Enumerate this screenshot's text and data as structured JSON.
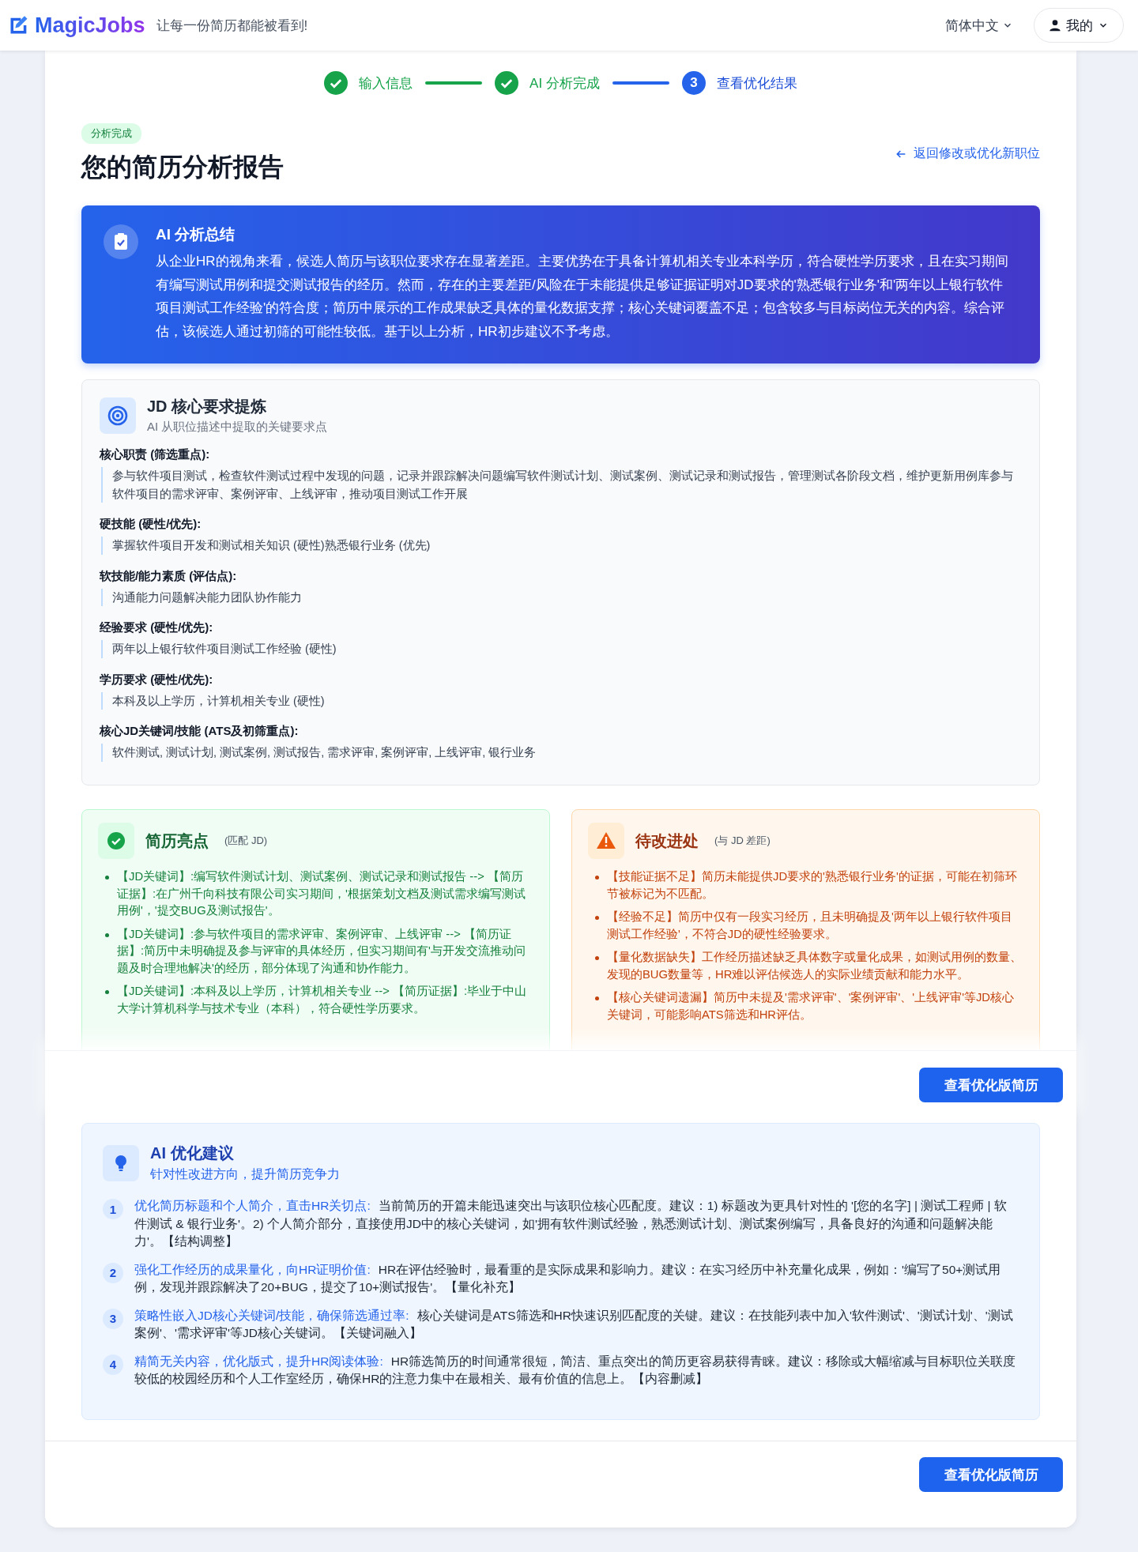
{
  "header": {
    "logo": "MagicJobs",
    "tagline": "让每一份简历都能被看到!",
    "language": "简体中文",
    "user_menu": "我的"
  },
  "steps": [
    {
      "label": "输入信息",
      "completed": true
    },
    {
      "label": "AI 分析完成",
      "completed": true
    },
    {
      "label": "查看优化结果",
      "completed": false,
      "number": "3"
    }
  ],
  "report": {
    "badge": "分析完成",
    "title": "您的简历分析报告",
    "back_link": "返回修改或优化新职位"
  },
  "summary": {
    "title": "AI 分析总结",
    "text": "从企业HR的视角来看，候选人简历与该职位要求存在显著差距。主要优势在于具备计算机相关专业本科学历，符合硬性学历要求，且在实习期间有编写测试用例和提交测试报告的经历。然而，存在的主要差距/风险在于未能提供足够证据证明对JD要求的'熟悉银行业务'和'两年以上银行软件项目测试工作经验'的符合度；简历中展示的工作成果缺乏具体的量化数据支撑；核心关键词覆盖不足；包含较多与目标岗位无关的内容。综合评估，该候选人通过初筛的可能性较低。基于以上分析，HR初步建议不予考虑。"
  },
  "jd": {
    "title": "JD 核心要求提炼",
    "subtitle": "AI 从职位描述中提取的关键要求点",
    "sections": [
      {
        "heading": "核心职责 (筛选重点):",
        "text": "参与软件项目测试，检查软件测试过程中发现的问题，记录并跟踪解决问题编写软件测试计划、测试案例、测试记录和测试报告，管理测试各阶段文档，维护更新用例库参与软件项目的需求评审、案例评审、上线评审，推动项目测试工作开展"
      },
      {
        "heading": "硬技能 (硬性/优先):",
        "text": "掌握软件项目开发和测试相关知识 (硬性)熟悉银行业务 (优先)"
      },
      {
        "heading": "软技能/能力素质 (评估点):",
        "text": "沟通能力问题解决能力团队协作能力"
      },
      {
        "heading": "经验要求 (硬性/优先):",
        "text": "两年以上银行软件项目测试工作经验 (硬性)"
      },
      {
        "heading": "学历要求 (硬性/优先):",
        "text": "本科及以上学历，计算机相关专业 (硬性)"
      },
      {
        "heading": "核心JD关键词/技能 (ATS及初筛重点):",
        "text": "软件测试, 测试计划, 测试案例, 测试报告, 需求评审, 案例评审, 上线评审, 银行业务"
      }
    ]
  },
  "findings": [
    {
      "kind": "strength",
      "title": "简历亮点",
      "note": "(匹配 JD)",
      "items": [
        "【JD关键词】:编写软件测试计划、测试案例、测试记录和测试报告 --> 【简历证据】:在广州千向科技有限公司实习期间，'根据策划文档及测试需求编写测试用例'，'提交BUG及测试报告'。",
        "【JD关键词】:参与软件项目的需求评审、案例评审、上线评审 --> 【简历证据】:简历中未明确提及参与评审的具体经历，但实习期间有'与开发交流推动问题及时合理地解决'的经历，部分体现了沟通和协作能力。",
        "【JD关键词】:本科及以上学历，计算机相关专业 --> 【简历证据】:毕业于中山大学计算机科学与技术专业（本科），符合硬性学历要求。"
      ]
    },
    {
      "kind": "gap",
      "title": "待改进处",
      "note": "(与 JD 差距)",
      "items": [
        "【技能证据不足】简历未能提供JD要求的'熟悉银行业务'的证据，可能在初筛环节被标记为不匹配。",
        "【经验不足】简历中仅有一段实习经历，且未明确提及'两年以上银行软件项目测试工作经验'，不符合JD的硬性经验要求。",
        "【量化数据缺失】工作经历描述缺乏具体数字或量化成果，如测试用例的数量、发现的BUG数量等，HR难以评估候选人的实际业绩贡献和能力水平。",
        "【核心关键词遗漏】简历中未提及'需求评审'、'案例评审'、'上线评审'等JD核心关键词，可能影响ATS筛选和HR评估。"
      ]
    }
  ],
  "view_button": "查看优化版简历",
  "suggestions": {
    "title": "AI 优化建议",
    "subtitle": "针对性改进方向，提升简历竞争力",
    "items": [
      {
        "number": "1",
        "heading": "优化简历标题和个人简介，直击HR关切点:",
        "text": "当前简历的开篇未能迅速突出与该职位核心匹配度。建议：1) 标题改为更具针对性的 '[您的名字] | 测试工程师 | 软件测试 & 银行业务'。2) 个人简介部分，直接使用JD中的核心关键词，如'拥有软件测试经验，熟悉测试计划、测试案例编写，具备良好的沟通和问题解决能力'。【结构调整】"
      },
      {
        "number": "2",
        "heading": "强化工作经历的成果量化，向HR证明价值:",
        "text": "HR在评估经验时，最看重的是实际成果和影响力。建议：在实习经历中补充量化成果，例如：'编写了50+测试用例，发现并跟踪解决了20+BUG，提交了10+测试报告'。【量化补充】"
      },
      {
        "number": "3",
        "heading": "策略性嵌入JD核心关键词/技能，确保筛选通过率:",
        "text": "核心关键词是ATS筛选和HR快速识别匹配度的关键。建议：在技能列表中加入'软件测试'、'测试计划'、'测试案例'、'需求评审'等JD核心关键词。【关键词融入】"
      },
      {
        "number": "4",
        "heading": "精简无关内容，优化版式，提升HR阅读体验:",
        "text": "HR筛选简历的时间通常很短，简洁、重点突出的简历更容易获得青睐。建议：移除或大幅缩减与目标职位关联度较低的校园经历和个人工作室经历，确保HR的注意力集中在最相关、最有价值的信息上。【内容删减】"
      }
    ]
  },
  "footer_button": "查看优化版简历"
}
